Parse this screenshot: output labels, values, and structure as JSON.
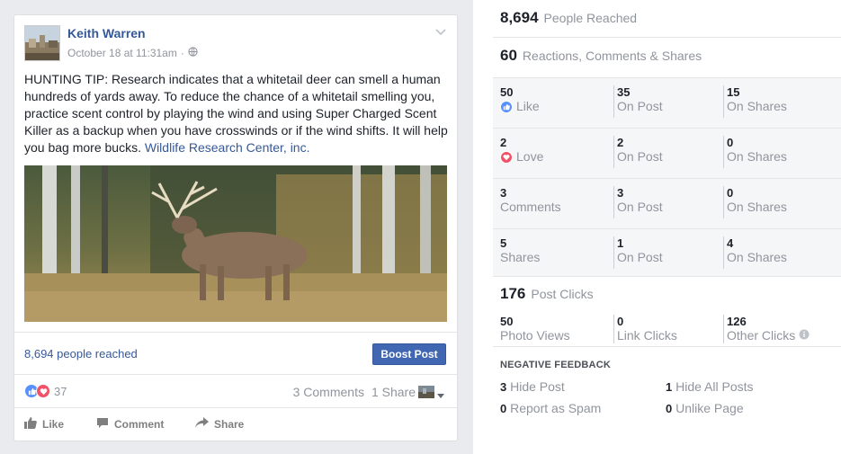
{
  "post": {
    "author": "Keith Warren",
    "timestamp": "October 18 at 11:31am",
    "privacy_icon": "globe-icon",
    "text": "HUNTING TIP: Research indicates that a whitetail deer can smell a human hundreds of yards away. To reduce the chance of a whitetail smelling you, practice scent control by playing the wind and using Super Charged Scent Killer as a backup when you have crosswinds or if the wind shifts. It will help you bag more bucks.",
    "link_text": "Wildlife Research Center, inc.",
    "people_reached": "8,694 people reached",
    "boost_label": "Boost Post",
    "reaction_count": "37",
    "comments": "3 Comments",
    "shares": "1 Share",
    "actions": {
      "like": "Like",
      "comment": "Comment",
      "share": "Share"
    }
  },
  "insights": {
    "reached": {
      "value": "8,694",
      "label": "People Reached"
    },
    "reactions": {
      "value": "60",
      "label": "Reactions, Comments & Shares"
    },
    "breakdown": [
      {
        "cells": [
          {
            "num": "50",
            "label": "Like",
            "icon": "like-icon"
          },
          {
            "num": "35",
            "label": "On Post"
          },
          {
            "num": "15",
            "label": "On Shares"
          }
        ]
      },
      {
        "cells": [
          {
            "num": "2",
            "label": "Love",
            "icon": "love-icon"
          },
          {
            "num": "2",
            "label": "On Post"
          },
          {
            "num": "0",
            "label": "On Shares"
          }
        ]
      },
      {
        "cells": [
          {
            "num": "3",
            "label": "Comments"
          },
          {
            "num": "3",
            "label": "On Post"
          },
          {
            "num": "0",
            "label": "On Shares"
          }
        ]
      },
      {
        "cells": [
          {
            "num": "5",
            "label": "Shares"
          },
          {
            "num": "1",
            "label": "On Post"
          },
          {
            "num": "4",
            "label": "On Shares"
          }
        ]
      }
    ],
    "post_clicks": {
      "value": "176",
      "label": "Post Clicks"
    },
    "clicks": [
      {
        "num": "50",
        "label": "Photo Views"
      },
      {
        "num": "0",
        "label": "Link Clicks"
      },
      {
        "num": "126",
        "label": "Other Clicks"
      }
    ],
    "negative_title": "NEGATIVE FEEDBACK",
    "negative": [
      {
        "num": "3",
        "label": "Hide Post"
      },
      {
        "num": "1",
        "label": "Hide All Posts"
      },
      {
        "num": "0",
        "label": "Report as Spam"
      },
      {
        "num": "0",
        "label": "Unlike Page"
      }
    ]
  },
  "colors": {
    "link": "#365899",
    "button": "#4267b2",
    "like": "#5890ff",
    "love": "#f25268"
  }
}
